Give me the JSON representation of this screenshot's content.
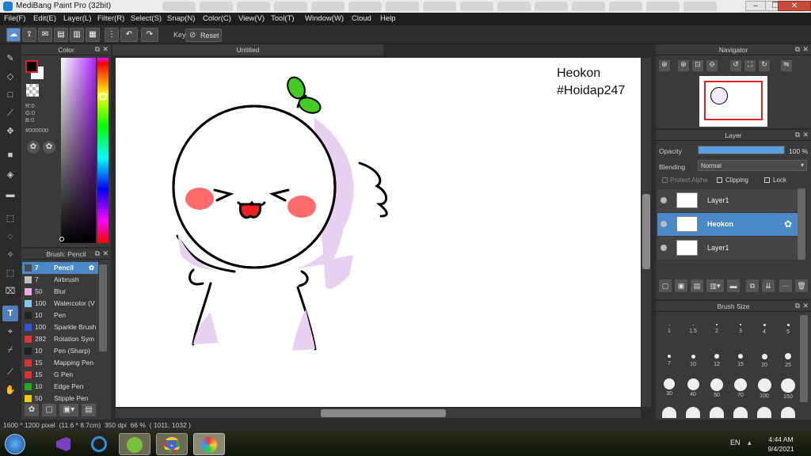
{
  "window": {
    "title": "MediBang Paint Pro (32bit)",
    "minimize": "–",
    "maximize": "❐",
    "close": "✕"
  },
  "menu": [
    "File(F)",
    "Edit(E)",
    "Layer(L)",
    "Filter(R)",
    "Select(S)",
    "Snap(N)",
    "Color(C)",
    "View(V)",
    "Tool(T)",
    "Window(W)",
    "Cloud",
    "Help"
  ],
  "toolbar": {
    "key_label": "Key",
    "reset_label": "Reset"
  },
  "color_panel": {
    "title": "Color",
    "r": "R:0",
    "g": "G:0",
    "b": "B:0",
    "hex": "#000000"
  },
  "brush_panel": {
    "title": "Brush: Pencil",
    "items": [
      {
        "num": "7",
        "name": "Pencil",
        "color": "#4a4a4a"
      },
      {
        "num": "7",
        "name": "Airbrush",
        "color": "#c0c0c0"
      },
      {
        "num": "50",
        "name": "Blur",
        "color": "#f0a8e8"
      },
      {
        "num": "100",
        "name": "Watercolor (V",
        "color": "#7fc8f0"
      },
      {
        "num": "10",
        "name": "Pen",
        "color": "#222222"
      },
      {
        "num": "100",
        "name": "Sparkle Brush",
        "color": "#3355dd"
      },
      {
        "num": "282",
        "name": "Rotation Sym",
        "color": "#dd3333"
      },
      {
        "num": "10",
        "name": "Pen (Sharp)",
        "color": "#222222"
      },
      {
        "num": "15",
        "name": "Mapping Pen",
        "color": "#dd3333"
      },
      {
        "num": "15",
        "name": "G Pen",
        "color": "#dd3333"
      },
      {
        "num": "10",
        "name": "Edge Pen",
        "color": "#22aa22"
      },
      {
        "num": "50",
        "name": "Stipple Pen",
        "color": "#eecc00"
      }
    ]
  },
  "canvas": {
    "tab": "Untitled",
    "note_line1": "Heokon",
    "note_line2": "#Hoidap247"
  },
  "status": {
    "size": "1600 * 1200 pixel",
    "physical": "(11.6 * 8.7cm)",
    "dpi": "350 dpi",
    "zoom": "66 %",
    "coords": "( 1011, 1032 )"
  },
  "navigator": {
    "title": "Navigator"
  },
  "layer_panel": {
    "title": "Layer",
    "opacity_label": "Opacity",
    "opacity_value": "100 %",
    "opacity_fraction": 1.0,
    "blending_label": "Blending",
    "blending_value": "Normal",
    "protect_alpha": "Protect Alpha",
    "clipping": "Clipping",
    "lock": "Lock",
    "layers": [
      {
        "name": "Layer1",
        "selected": false
      },
      {
        "name": "Heokon",
        "selected": true
      },
      {
        "name": "Layer1",
        "selected": false
      }
    ]
  },
  "brush_size": {
    "title": "Brush Size",
    "row1": [
      "1",
      "1.5",
      "2",
      "3",
      "4",
      "5"
    ],
    "row2": [
      "7",
      "10",
      "12",
      "15",
      "20",
      "25"
    ],
    "row3": [
      "30",
      "40",
      "50",
      "70",
      "100",
      "150"
    ]
  },
  "taskbar": {
    "lang": "EN",
    "time": "4:44 AM",
    "date": "9/4/2021"
  }
}
